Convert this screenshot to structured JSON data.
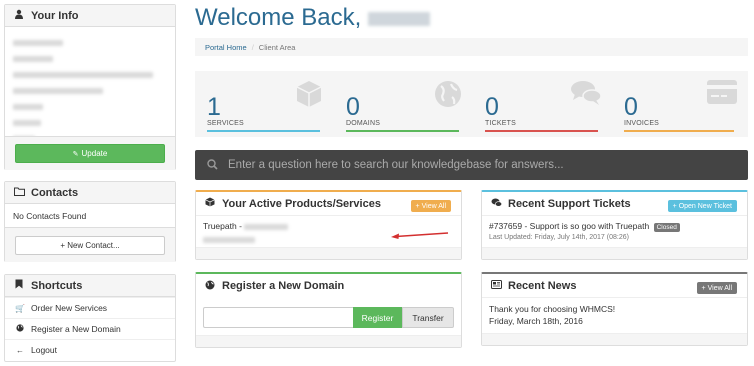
{
  "sidebar": {
    "your_info": {
      "title": "Your Info",
      "update_label": "Update"
    },
    "contacts": {
      "title": "Contacts",
      "empty_text": "No Contacts Found",
      "new_contact_label": "+ New Contact..."
    },
    "shortcuts": {
      "title": "Shortcuts",
      "items": [
        {
          "label": "Order New Services",
          "icon": "cart-icon"
        },
        {
          "label": "Register a New Domain",
          "icon": "globe-icon"
        },
        {
          "label": "Logout",
          "icon": "logout-arrow-icon"
        }
      ]
    }
  },
  "header": {
    "welcome": "Welcome Back,",
    "breadcrumb": {
      "home": "Portal Home",
      "separator": "/",
      "current": "Client Area"
    }
  },
  "stats": [
    {
      "value": "1",
      "label": "SERVICES",
      "color": "#5bc0de",
      "icon": "cube-icon"
    },
    {
      "value": "0",
      "label": "DOMAINS",
      "color": "#5cb85c",
      "icon": "globe-icon"
    },
    {
      "value": "0",
      "label": "TICKETS",
      "color": "#d9534f",
      "icon": "comments-icon"
    },
    {
      "value": "0",
      "label": "INVOICES",
      "color": "#f0ad4e",
      "icon": "credit-card-icon"
    }
  ],
  "search": {
    "placeholder": "Enter a question here to search our knowledgebase for answers..."
  },
  "products": {
    "title": "Your Active Products/Services",
    "view_all": "View All",
    "item_prefix": "Truepath -",
    "accent": "#f0ad4e"
  },
  "tickets": {
    "title": "Recent Support Tickets",
    "open_new": "Open New Ticket",
    "accent": "#5bc0de",
    "item_title": "#737659 - Support is so goo with Truepath",
    "item_status": "Closed",
    "item_updated": "Last Updated: Friday, July 14th, 2017 (08:26)"
  },
  "domain": {
    "title": "Register a New Domain",
    "register": "Register",
    "transfer": "Transfer",
    "accent": "#5cb85c"
  },
  "news": {
    "title": "Recent News",
    "view_all": "View All",
    "accent": "#777777",
    "item_title": "Thank you for choosing WHMCS!",
    "item_date": "Friday, March 18th, 2016"
  }
}
